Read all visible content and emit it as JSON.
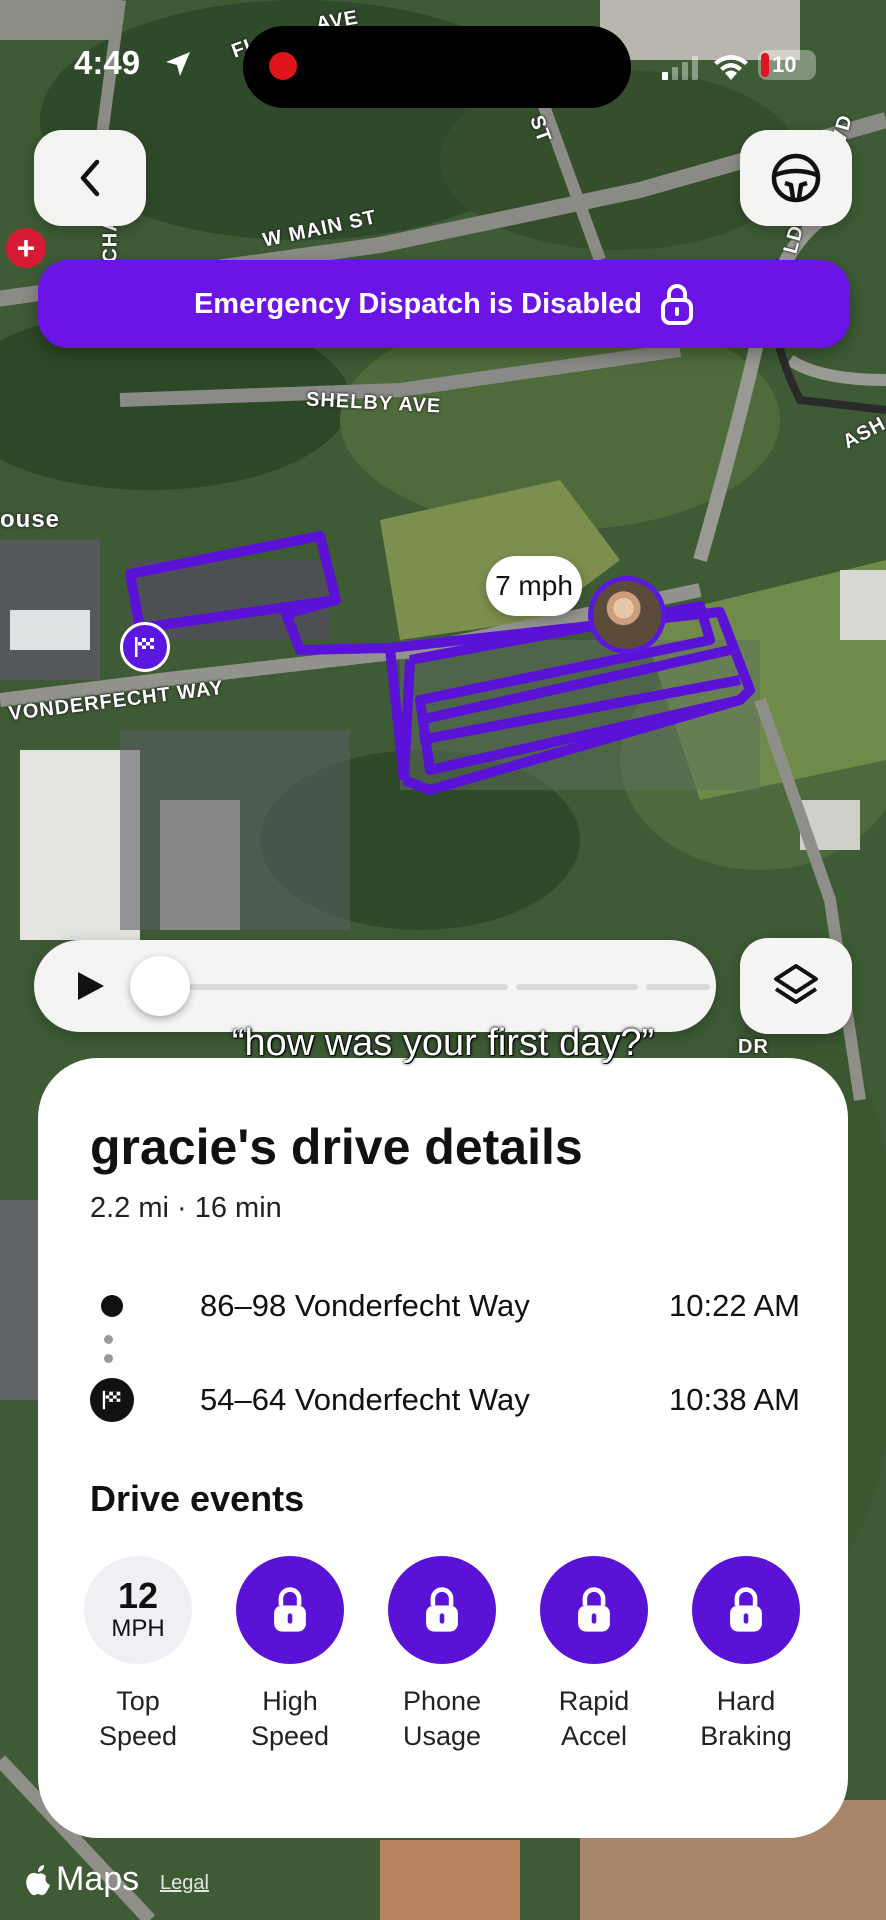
{
  "status_bar": {
    "time": "4:49",
    "battery": "10"
  },
  "banner": {
    "text": "Emergency Dispatch is Disabled"
  },
  "map": {
    "labels": [
      "W MAIN ST",
      "SHELBY AVE",
      "VONDERFECHT WAY",
      "ouse",
      "ASH",
      "ST",
      "FI",
      "AVE",
      "CHA",
      "LD",
      "VD",
      "DR"
    ],
    "speed": "7 mph"
  },
  "caption": "“how was your first day?”",
  "drive": {
    "title": "gracie's drive details",
    "summary": "2.2 mi · 16 min",
    "start": {
      "address": "86–98 Vonderfecht Way",
      "time": "10:22 AM"
    },
    "end": {
      "address": "54–64 Vonderfecht Way",
      "time": "10:38 AM"
    }
  },
  "events": {
    "title": "Drive events",
    "items": [
      {
        "label": "Top\nSpeed",
        "value": "12",
        "unit": "MPH",
        "locked": false
      },
      {
        "label": "High\nSpeed",
        "locked": true
      },
      {
        "label": "Phone\nUsage",
        "locked": true
      },
      {
        "label": "Rapid\nAccel",
        "locked": true
      },
      {
        "label": "Hard\nBraking",
        "locked": true
      }
    ]
  },
  "footer": {
    "maps": "Maps",
    "legal": "Legal"
  },
  "colors": {
    "accent": "#6a14e6",
    "route": "#5a12d6"
  }
}
